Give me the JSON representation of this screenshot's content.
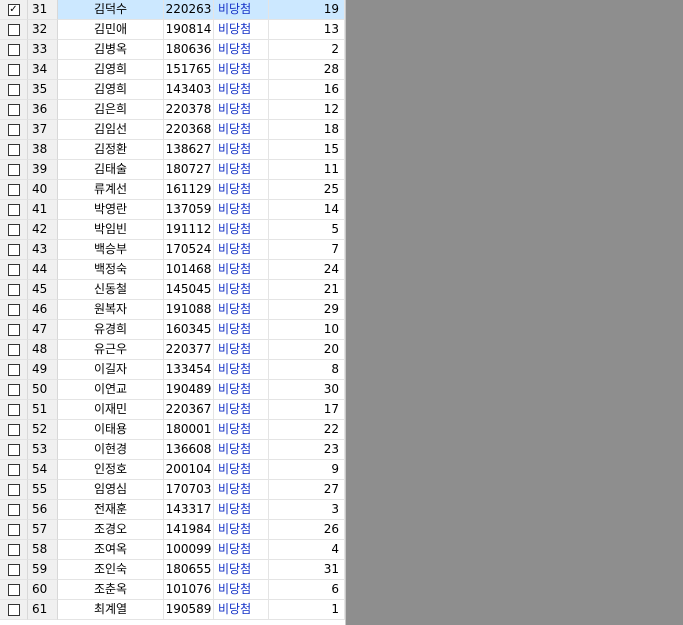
{
  "rows": [
    {
      "num": "31",
      "name": "김덕수",
      "code": "220263",
      "status": "비당첨",
      "count": "19",
      "checked": true
    },
    {
      "num": "32",
      "name": "김민애",
      "code": "190814",
      "status": "비당첨",
      "count": "13",
      "checked": false
    },
    {
      "num": "33",
      "name": "김병옥",
      "code": "180636",
      "status": "비당첨",
      "count": "2",
      "checked": false
    },
    {
      "num": "34",
      "name": "김영희",
      "code": "151765",
      "status": "비당첨",
      "count": "28",
      "checked": false
    },
    {
      "num": "35",
      "name": "김영희",
      "code": "143403",
      "status": "비당첨",
      "count": "16",
      "checked": false
    },
    {
      "num": "36",
      "name": "김은희",
      "code": "220378",
      "status": "비당첨",
      "count": "12",
      "checked": false
    },
    {
      "num": "37",
      "name": "김임선",
      "code": "220368",
      "status": "비당첨",
      "count": "18",
      "checked": false
    },
    {
      "num": "38",
      "name": "김정환",
      "code": "138627",
      "status": "비당첨",
      "count": "15",
      "checked": false
    },
    {
      "num": "39",
      "name": "김태술",
      "code": "180727",
      "status": "비당첨",
      "count": "11",
      "checked": false
    },
    {
      "num": "40",
      "name": "류계선",
      "code": "161129",
      "status": "비당첨",
      "count": "25",
      "checked": false
    },
    {
      "num": "41",
      "name": "박영란",
      "code": "137059",
      "status": "비당첨",
      "count": "14",
      "checked": false
    },
    {
      "num": "42",
      "name": "박임빈",
      "code": "191112",
      "status": "비당첨",
      "count": "5",
      "checked": false
    },
    {
      "num": "43",
      "name": "백승부",
      "code": "170524",
      "status": "비당첨",
      "count": "7",
      "checked": false
    },
    {
      "num": "44",
      "name": "백정숙",
      "code": "101468",
      "status": "비당첨",
      "count": "24",
      "checked": false
    },
    {
      "num": "45",
      "name": "신동철",
      "code": "145045",
      "status": "비당첨",
      "count": "21",
      "checked": false
    },
    {
      "num": "46",
      "name": "원복자",
      "code": "191088",
      "status": "비당첨",
      "count": "29",
      "checked": false
    },
    {
      "num": "47",
      "name": "유경희",
      "code": "160345",
      "status": "비당첨",
      "count": "10",
      "checked": false
    },
    {
      "num": "48",
      "name": "유근우",
      "code": "220377",
      "status": "비당첨",
      "count": "20",
      "checked": false
    },
    {
      "num": "49",
      "name": "이길자",
      "code": "133454",
      "status": "비당첨",
      "count": "8",
      "checked": false
    },
    {
      "num": "50",
      "name": "이연교",
      "code": "190489",
      "status": "비당첨",
      "count": "30",
      "checked": false
    },
    {
      "num": "51",
      "name": "이재민",
      "code": "220367",
      "status": "비당첨",
      "count": "17",
      "checked": false
    },
    {
      "num": "52",
      "name": "이태용",
      "code": "180001",
      "status": "비당첨",
      "count": "22",
      "checked": false
    },
    {
      "num": "53",
      "name": "이현경",
      "code": "136608",
      "status": "비당첨",
      "count": "23",
      "checked": false
    },
    {
      "num": "54",
      "name": "인정호",
      "code": "200104",
      "status": "비당첨",
      "count": "9",
      "checked": false
    },
    {
      "num": "55",
      "name": "임영심",
      "code": "170703",
      "status": "비당첨",
      "count": "27",
      "checked": false
    },
    {
      "num": "56",
      "name": "전재훈",
      "code": "143317",
      "status": "비당첨",
      "count": "3",
      "checked": false
    },
    {
      "num": "57",
      "name": "조경오",
      "code": "141984",
      "status": "비당첨",
      "count": "26",
      "checked": false
    },
    {
      "num": "58",
      "name": "조여옥",
      "code": "100099",
      "status": "비당첨",
      "count": "4",
      "checked": false
    },
    {
      "num": "59",
      "name": "조인숙",
      "code": "180655",
      "status": "비당첨",
      "count": "31",
      "checked": false
    },
    {
      "num": "60",
      "name": "조춘옥",
      "code": "101076",
      "status": "비당첨",
      "count": "6",
      "checked": false
    },
    {
      "num": "61",
      "name": "최계열",
      "code": "190589",
      "status": "비당첨",
      "count": "1",
      "checked": false
    }
  ],
  "selected_row": "31",
  "colors": {
    "status_text": "#1432c8",
    "selected_bg": "#cce8ff",
    "empty_area": "#8e8e8e"
  },
  "icons": {
    "checked": "✓"
  }
}
